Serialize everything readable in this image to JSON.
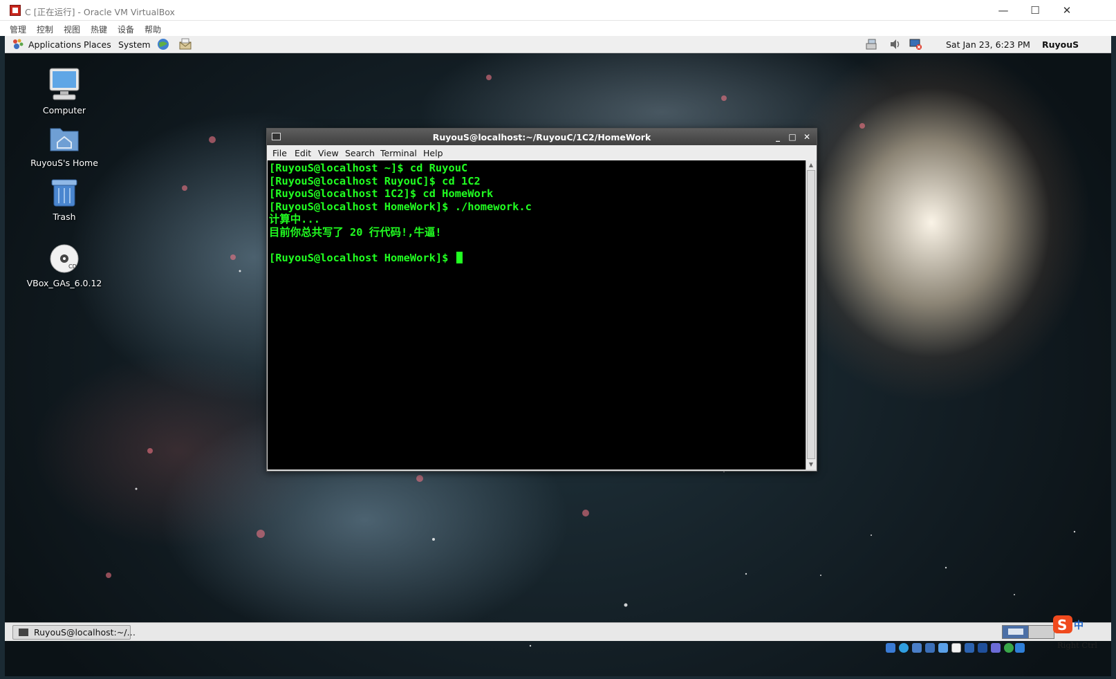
{
  "host": {
    "title": "C [正在运行] - Oracle VM VirtualBox",
    "menu": [
      "管理",
      "控制",
      "视图",
      "热键",
      "设备",
      "帮助"
    ],
    "status_hotkey": "Right Ctrl",
    "ime_label": "中"
  },
  "guest_panel": {
    "menus": [
      "Applications",
      "Places",
      "System"
    ],
    "clock": "Sat Jan 23,  6:23 PM",
    "user": "RuyouS"
  },
  "desktop_icons": [
    {
      "label": "Computer",
      "icon": "computer-icon"
    },
    {
      "label": "RuyouS's Home",
      "icon": "home-folder-icon"
    },
    {
      "label": "Trash",
      "icon": "trash-icon"
    },
    {
      "label": "VBox_GAs_6.0.12",
      "icon": "cd-icon"
    }
  ],
  "terminal": {
    "title": "RuyouS@localhost:~/RuyouC/1C2/HomeWork",
    "menu": [
      "File",
      "Edit",
      "View",
      "Search",
      "Terminal",
      "Help"
    ],
    "lines": [
      "[RuyouS@localhost ~]$ cd RuyouC",
      "[RuyouS@localhost RuyouC]$ cd 1C2",
      "[RuyouS@localhost 1C2]$ cd HomeWork",
      "[RuyouS@localhost HomeWork]$ ./homework.c",
      "计算中...",
      "目前你总共写了 20 行代码!,牛逼!",
      "",
      "[RuyouS@localhost HomeWork]$ "
    ],
    "text_color": "#21ff21",
    "background": "#000000"
  },
  "taskbar": {
    "task_label": "RuyouS@localhost:~/…"
  },
  "colors": {
    "panel": "#efefef",
    "terminal_title": "#4a4a4a",
    "workspace_active": "#4b6fa6"
  }
}
